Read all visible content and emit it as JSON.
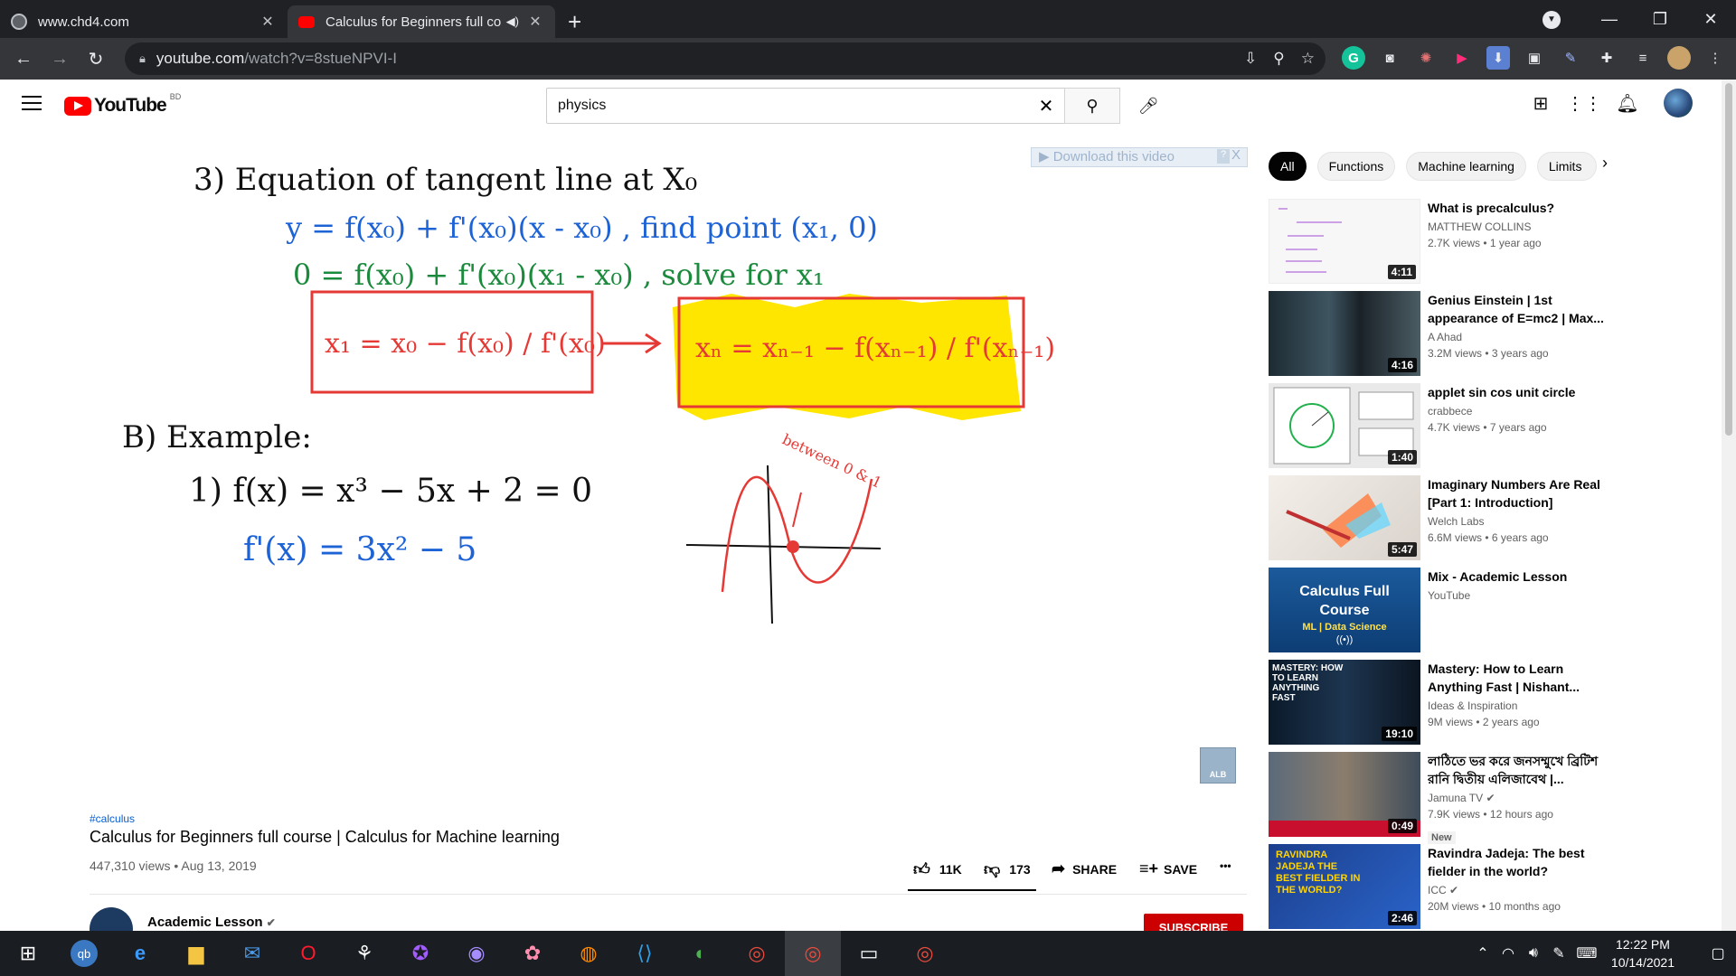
{
  "browser": {
    "tabs": [
      {
        "title": "www.chd4.com",
        "active": false
      },
      {
        "title": "Calculus for Beginners full co",
        "active": true
      }
    ],
    "url_host": "youtube.com",
    "url_path": "/watch?v=8stueNPVI-I",
    "window": {
      "minimize": "—",
      "maximize": "❐",
      "close": "✕"
    }
  },
  "youtube": {
    "logo_text": "YouTube",
    "country_code": "BD",
    "search_value": "physics"
  },
  "video": {
    "overlay_download": "▶ Download this video",
    "overlay_help": "?",
    "overlay_close": "X",
    "watermark": "ALB",
    "whiteboard": {
      "line1": "3) Equation of tangent line at X₀",
      "line2": "y = f(x₀) + f'(x₀)(x - x₀) , find point (x₁, 0)",
      "line3": "0 = f(x₀) + f'(x₀)(x₁ - x₀) , solve for x₁",
      "box1": "x₁ = x₀ − f(x₀) / f'(x₀)",
      "box2": "xₙ = xₙ₋₁ − f(xₙ₋₁) / f'(xₙ₋₁)",
      "example": "B) Example:",
      "ex1": "1) f(x) = x³ − 5x + 2 = 0",
      "ex2": "f'(x) = 3x² − 5",
      "note": "between 0 & 1"
    },
    "hashtag": "#calculus",
    "title": "Calculus for Beginners full course | Calculus for Machine learning",
    "views_date": "447,310 views • Aug 13, 2019",
    "likes": "11K",
    "dislikes": "173",
    "share": "SHARE",
    "save": "SAVE",
    "more": "•••",
    "channel": "Academic Lesson",
    "subscribe": "SUBSCRIBE"
  },
  "chips": [
    "All",
    "Functions",
    "Machine learning",
    "Limits"
  ],
  "recommendations": [
    {
      "title": "What is precalculus?",
      "channel": "MATTHEW COLLINS",
      "meta": "2.7K views • 1 year ago",
      "duration": "4:11"
    },
    {
      "title": "Genius Einstein | 1st appearance of E=mc2 | Max...",
      "channel": "A Ahad",
      "meta": "3.2M views • 3 years ago",
      "duration": "4:16"
    },
    {
      "title": "applet sin cos unit circle",
      "channel": "crabbece",
      "meta": "4.7K views • 7 years ago",
      "duration": "1:40"
    },
    {
      "title": "Imaginary Numbers Are Real [Part 1: Introduction]",
      "channel": "Welch Labs",
      "meta": "6.6M views • 6 years ago",
      "duration": "5:47"
    },
    {
      "title": "Mix - Academic Lesson",
      "channel": "YouTube",
      "meta": "",
      "duration": "",
      "thumb_text": "Calculus Full Course",
      "thumb_sub": "ML | Data Science"
    },
    {
      "title": "Mastery: How to Learn Anything Fast | Nishant...",
      "channel": "Ideas & Inspiration",
      "meta": "9M views • 2 years ago",
      "duration": "19:10",
      "thumb_text": "MASTERY: HOW TO LEARN ANYTHING FAST"
    },
    {
      "title": "লাঠিতে ভর করে জনসম্মুখে ব্রিটিশ রানি দ্বিতীয় এলিজাবেথ |...",
      "channel": "Jamuna TV",
      "meta": "7.9K views • 12 hours ago",
      "duration": "0:49",
      "badge": "New"
    },
    {
      "title": "Ravindra Jadeja: The best fielder in the world?",
      "channel": "ICC",
      "meta": "20M views • 10 months ago",
      "duration": "2:46",
      "thumb_text": "RAVINDRA JADEJA THE BEST FIELDER IN THE WORLD?"
    }
  ],
  "taskbar": {
    "time": "12:22 PM",
    "date": "10/14/2021"
  }
}
